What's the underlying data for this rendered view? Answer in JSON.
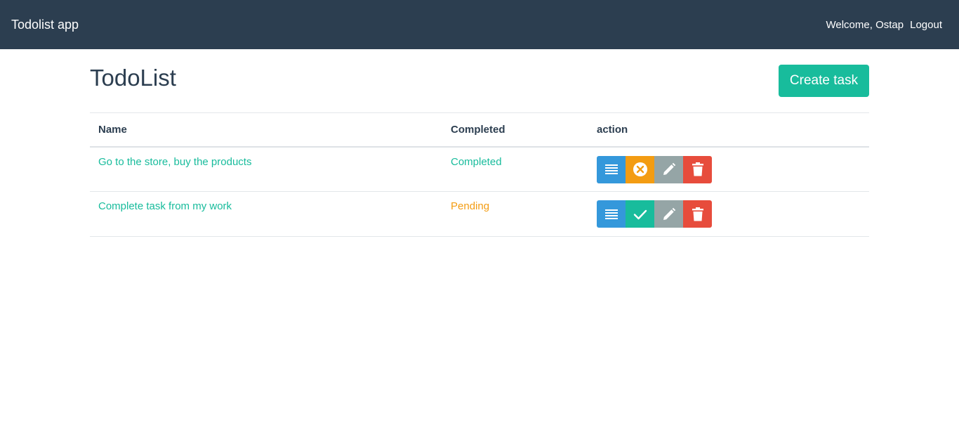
{
  "navbar": {
    "brand": "Todolist app",
    "welcome": "Welcome, Ostap",
    "logout": "Logout"
  },
  "page": {
    "title": "TodoList",
    "create_button": "Create task"
  },
  "table": {
    "headers": [
      "Name",
      "Completed",
      "action"
    ],
    "rows": [
      {
        "name": "Go to the store, buy the products",
        "status": "Completed",
        "toggle_icon": "cancel-circle-icon"
      },
      {
        "name": "Complete task from my work",
        "status": "Pending",
        "toggle_icon": "check-icon"
      }
    ]
  },
  "colors": {
    "navbar": "#2c3e50",
    "primary": "#18bc9c",
    "info": "#3498db",
    "warning": "#f39c12",
    "secondary": "#95a5a6",
    "danger": "#e74c3c"
  },
  "icons": [
    "details-list-icon",
    "cancel-circle-icon",
    "check-icon",
    "pencil-icon",
    "trash-icon"
  ]
}
